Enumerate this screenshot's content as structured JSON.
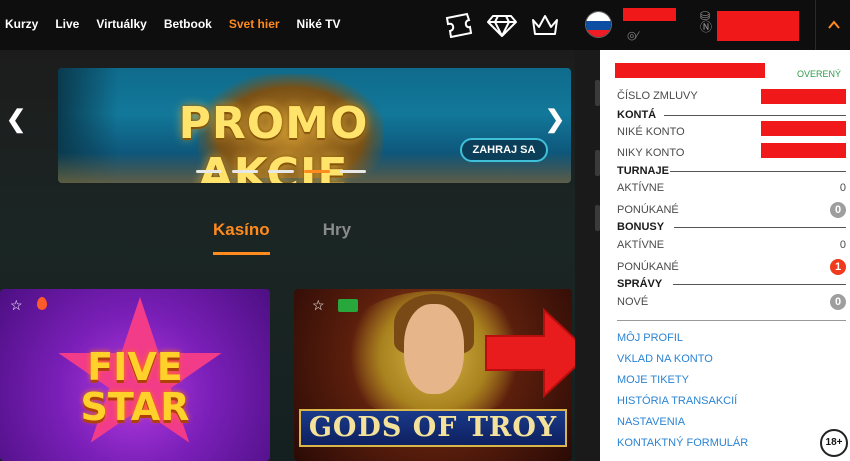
{
  "nav": {
    "items": [
      "Kurzy",
      "Live",
      "Virtuálky",
      "Betbook",
      "Svet hier",
      "Niké TV"
    ],
    "active_index": 4
  },
  "header_icons": [
    "ticket-icon",
    "diamond-icon",
    "crown-icon",
    "slovakia-flag-icon",
    "hidden-eye-icon",
    "coins-icon",
    "chevron-up-icon"
  ],
  "banner": {
    "title": "PROMO AKCIE",
    "button": "ZAHRAJ SA",
    "slide_count": 5,
    "active_slide": 4
  },
  "tabs": {
    "active": "Kasíno",
    "other": "Hry"
  },
  "games": [
    {
      "title": "FIVE STAR"
    },
    {
      "title": "GODS OF TROY"
    }
  ],
  "account": {
    "status": "OVERENÝ",
    "contract_label": "ČÍSLO ZMLUVY",
    "sections": {
      "accounts": "KONTÁ",
      "tournaments": "TURNAJE",
      "bonuses": "BONUSY",
      "messages": "SPRÁVY"
    },
    "nike_account": "NIKÉ KONTO",
    "niky_account": "NIKY KONTO",
    "tournaments": {
      "active_label": "AKTÍVNE",
      "active_value": "0",
      "offered_label": "PONÚKANÉ",
      "offered_value": "0"
    },
    "bonuses": {
      "active_label": "AKTÍVNE",
      "active_value": "0",
      "offered_label": "PONÚKANÉ",
      "offered_value": "1"
    },
    "messages": {
      "new_label": "NOVÉ",
      "new_value": "0"
    },
    "links": [
      "MÔJ PROFIL",
      "VKLAD NA KONTO",
      "MOJE TIKETY",
      "HISTÓRIA TRANSAKCIÍ",
      "NASTAVENIA",
      "KONTAKTNÝ FORMULÁR"
    ]
  },
  "age_badge": "18+",
  "colors": {
    "accent": "#ff8a1e",
    "redaction": "#f01818",
    "link": "#2a84d4",
    "verified": "#2e9c4a"
  }
}
